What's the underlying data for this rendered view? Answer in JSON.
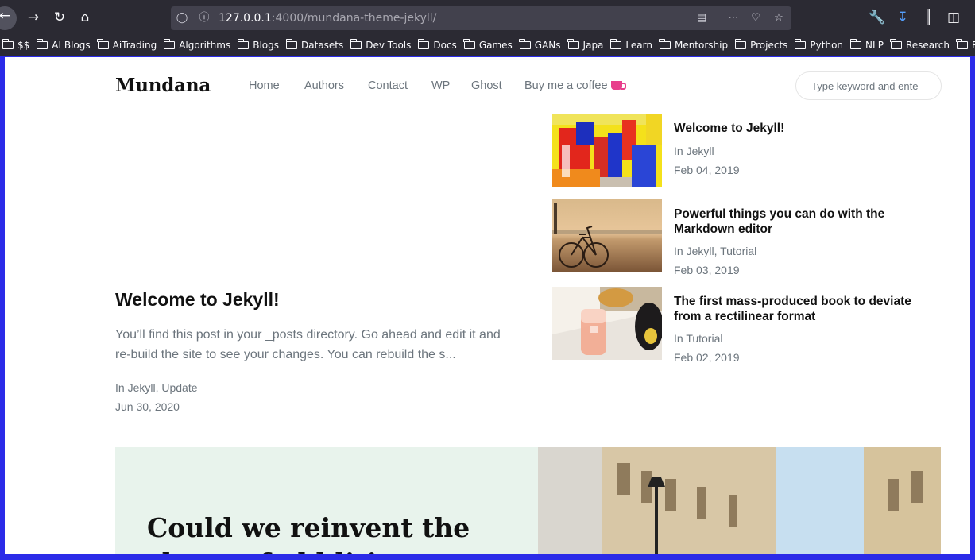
{
  "browser": {
    "url_host": "127.0.0.1",
    "url_path": ":4000/mundana-theme-jekyll/",
    "bookmarks": [
      "$$",
      "AI Blogs",
      "AiTrading",
      "Algorithms",
      "Blogs",
      "Datasets",
      "Dev Tools",
      "Docs",
      "Games",
      "GANs",
      "Japa",
      "Learn",
      "Mentorship",
      "Projects",
      "Python",
      "NLP",
      "Research",
      "RL"
    ]
  },
  "site": {
    "brand": "Mundana",
    "nav": [
      "Home",
      "Authors",
      "Contact",
      "WP",
      "Ghost",
      "Buy me a coffee"
    ],
    "search_placeholder": "Type keyword and ente"
  },
  "featured": {
    "title": "Welcome to Jekyll!",
    "excerpt": "You’ll find this post in your _posts directory. Go ahead and edit it and re-build the site to see your changes. You can rebuild the s...",
    "categories": "In Jekyll, Update",
    "date": "Jun 30, 2020"
  },
  "posts": [
    {
      "title": "Welcome to Jekyll!",
      "categories": "In Jekyll",
      "date": "Feb 04, 2019",
      "image": "abstract-painting"
    },
    {
      "title": "Powerful things you can do with the Markdown editor",
      "categories": "In Jekyll, Tutorial",
      "date": "Feb 03, 2019",
      "image": "bicycle-beach"
    },
    {
      "title": "The first mass-produced book to deviate from a rectilinear format",
      "categories": "In Tutorial",
      "date": "Feb 02, 2019",
      "image": "drink-table"
    }
  ],
  "jumbotron": {
    "title": "Could we reinvent the shape of old liti"
  },
  "colors": {
    "accent": "#e83e8c",
    "jumbotron_bg": "#e8f3ec",
    "chrome": "#2b2a33"
  }
}
